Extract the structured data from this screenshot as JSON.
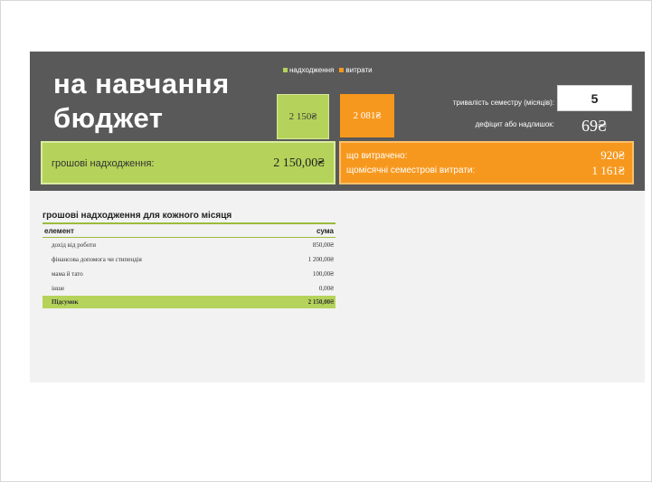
{
  "header": {
    "title_line1": "на навчання",
    "title_line2": "бюджет",
    "legend": {
      "income_label": "надходження",
      "expense_label": "витрати",
      "income_color": "#b5d35a",
      "expense_color": "#f7981e"
    },
    "income_box_value": "2 150₴",
    "expense_box_value": "2 081₴",
    "semester_label": "тривалість семестру (місяців):",
    "semester_months": "5",
    "deficit_label": "дефіцит або надлишок:",
    "deficit_value": "69₴"
  },
  "summary": {
    "income_label": "грошові надходження:",
    "income_value": "2 150,00₴",
    "spent_label": "що витрачено:",
    "spent_value": "920₴",
    "monthly_label": "щомісячні семестрові витрати:",
    "monthly_value": "1 161₴"
  },
  "income_table": {
    "title": "грошові надходження для кожного місяця",
    "col_item": "елемент",
    "col_amount": "сума",
    "rows": [
      {
        "item": "дохід від роботи",
        "amount": "850,00₴"
      },
      {
        "item": "фінансова допомога чи стипендія",
        "amount": "1 200,00₴"
      },
      {
        "item": "мама й тато",
        "amount": "100,00₴"
      },
      {
        "item": "інше",
        "amount": "0,00₴"
      }
    ],
    "total_label": "Підсумок",
    "total_value": "2 150,00₴"
  }
}
